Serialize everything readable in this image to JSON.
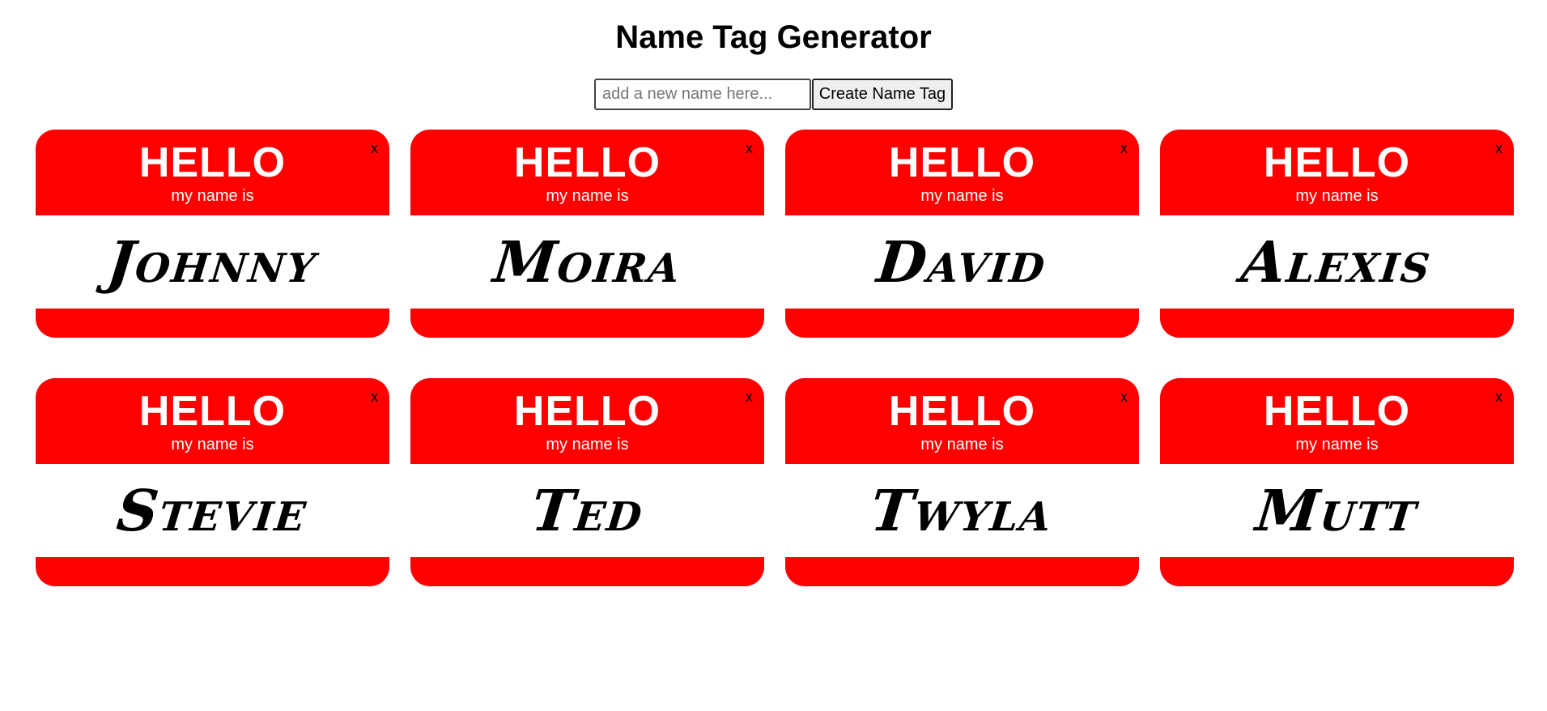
{
  "title": "Name Tag Generator",
  "form": {
    "placeholder": "add a new name here...",
    "value": "",
    "button_label": "Create Name Tag"
  },
  "tag_template": {
    "hello": "HELLO",
    "subtitle": "my name is",
    "close": "x"
  },
  "colors": {
    "tag_red": "#ff0000",
    "tag_white": "#ffffff"
  },
  "tags": [
    {
      "name": "Johnny"
    },
    {
      "name": "Moira"
    },
    {
      "name": "David"
    },
    {
      "name": "Alexis"
    },
    {
      "name": "Stevie"
    },
    {
      "name": "Ted"
    },
    {
      "name": "Twyla"
    },
    {
      "name": "Mutt"
    }
  ]
}
